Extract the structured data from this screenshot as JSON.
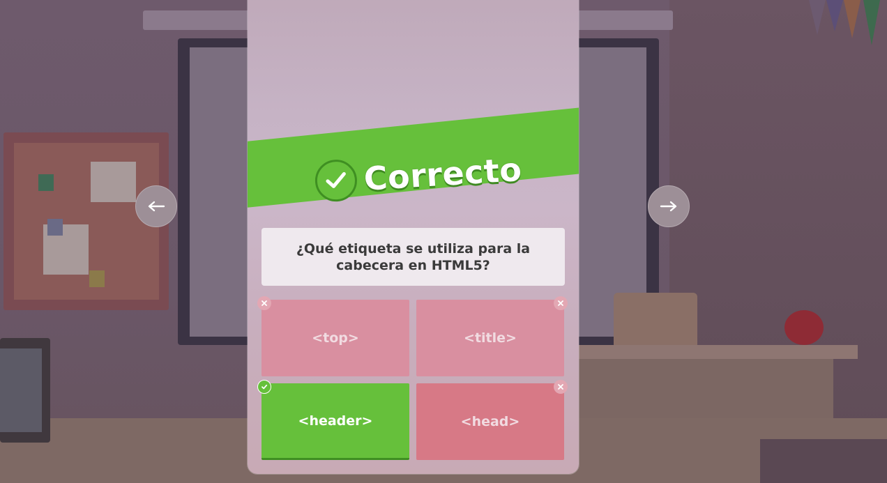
{
  "result": {
    "label": "Correcto",
    "icon": "check-circle-icon",
    "color": "#66c03b"
  },
  "question": {
    "text": "¿Qué etiqueta se utiliza para la cabecera en HTML5?"
  },
  "answers": [
    {
      "label": "<top>",
      "status": "incorrect",
      "icon": "close-icon"
    },
    {
      "label": "<title>",
      "status": "incorrect",
      "icon": "close-icon"
    },
    {
      "label": "<header>",
      "status": "correct",
      "icon": "check-icon"
    },
    {
      "label": "<head>",
      "status": "incorrect",
      "icon": "close-icon"
    }
  ],
  "navigation": {
    "prev_icon": "arrow-left-icon",
    "next_icon": "arrow-right-icon"
  },
  "colors": {
    "correct": "#66c03b",
    "incorrect": "#d98fa0"
  }
}
